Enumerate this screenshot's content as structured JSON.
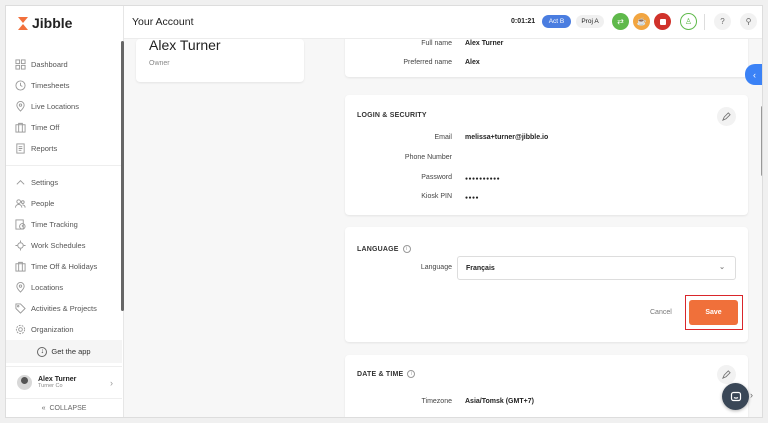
{
  "app": {
    "name": "Jibble"
  },
  "sidebar": {
    "items": [
      {
        "label": "Dashboard",
        "icon": "dashboard-icon"
      },
      {
        "label": "Timesheets",
        "icon": "clock-icon"
      },
      {
        "label": "Live Locations",
        "icon": "location-pin-icon"
      },
      {
        "label": "Time Off",
        "icon": "suitcase-icon"
      },
      {
        "label": "Reports",
        "icon": "report-icon"
      }
    ],
    "settings_items": [
      {
        "label": "Settings",
        "icon": "chevron-up-icon"
      },
      {
        "label": "People",
        "icon": "people-icon"
      },
      {
        "label": "Time Tracking",
        "icon": "time-tracking-icon"
      },
      {
        "label": "Work Schedules",
        "icon": "schedule-icon"
      },
      {
        "label": "Time Off & Holidays",
        "icon": "suitcase-icon"
      },
      {
        "label": "Locations",
        "icon": "location-pin-icon"
      },
      {
        "label": "Activities & Projects",
        "icon": "tag-icon"
      },
      {
        "label": "Organization",
        "icon": "gear-icon"
      }
    ],
    "get_app_label": "Get the app",
    "user": {
      "name": "Alex Turner",
      "org": "Turner Co"
    },
    "collapse_label": "COLLAPSE"
  },
  "topbar": {
    "title": "Your Account",
    "timer": "0:01:21",
    "activity_badge": "Act B",
    "project_badge": "Proj A"
  },
  "profile": {
    "name": "Alex Turner",
    "role": "Owner"
  },
  "name_card": {
    "full_name_label": "Full name",
    "full_name_value": "Alex Turner",
    "preferred_name_label": "Preferred name",
    "preferred_name_value": "Alex"
  },
  "login_security": {
    "title": "LOGIN & SECURITY",
    "email_label": "Email",
    "email_value": "melissa+turner@jibble.io",
    "phone_label": "Phone Number",
    "phone_value": "",
    "password_label": "Password",
    "password_value": "●●●●●●●●●●",
    "kiosk_label": "Kiosk PIN",
    "kiosk_value": "●●●●"
  },
  "language": {
    "title": "LANGUAGE",
    "field_label": "Language",
    "selected": "Français",
    "cancel_label": "Cancel",
    "save_label": "Save"
  },
  "date_time": {
    "title": "DATE & TIME",
    "timezone_label": "Timezone",
    "timezone_value": "Asia/Tomsk (GMT+7)"
  },
  "colors": {
    "brand_orange": "#f0703a",
    "accent_blue": "#3b82f6",
    "highlight_red": "#d9262b",
    "resume_green": "#5fb94b",
    "break_orange": "#f2a540",
    "stop_red": "#d0322b"
  }
}
